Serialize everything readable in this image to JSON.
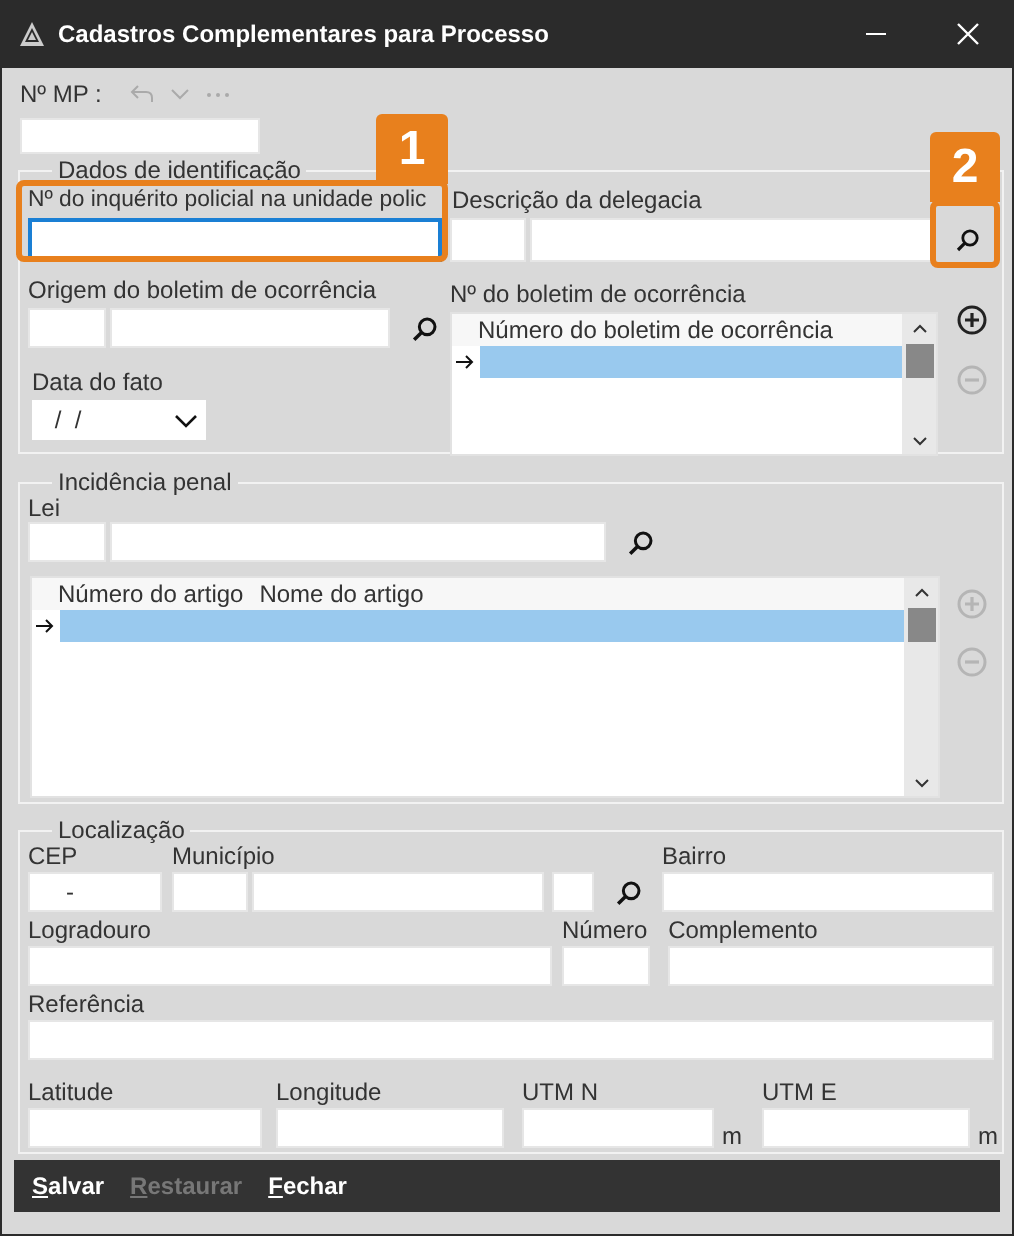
{
  "window": {
    "title": "Cadastros Complementares para Processo"
  },
  "header": {
    "mp_label": "Nº MP :"
  },
  "identificacao": {
    "title": "Dados de identificação",
    "inquerito": {
      "label": "Nº do inquérito policial na unidade polic",
      "focused": true
    },
    "delegacia": {
      "label": "Descrição da delegacia"
    },
    "origem": {
      "label": "Origem do boletim de ocorrência"
    },
    "data": {
      "label": "Data do fato",
      "value": " /  /"
    },
    "boletim": {
      "label": "Nº do boletim de ocorrência",
      "columns": [
        "Número do boletim de ocorrência"
      ],
      "add_disabled": false,
      "remove_disabled": true
    }
  },
  "incidencia": {
    "title": "Incidência penal",
    "lei_label": "Lei",
    "columns": [
      "Número do artigo",
      "Nome do artigo"
    ],
    "add_disabled": true,
    "remove_disabled": true
  },
  "localizacao": {
    "title": "Localização",
    "fields": [
      {
        "label": "CEP",
        "value": "-"
      },
      {
        "label": "Município"
      },
      {
        "label": "Bairro"
      },
      {
        "label": "Logradouro"
      },
      {
        "label": "Número"
      },
      {
        "label": "Complemento"
      },
      {
        "label": "Referência"
      },
      {
        "label": "Latitude"
      },
      {
        "label": "Longitude"
      },
      {
        "label": "UTM N",
        "unit": "m"
      },
      {
        "label": "UTM E",
        "unit": "m"
      }
    ]
  },
  "footer": {
    "buttons": [
      {
        "label": "Salvar",
        "disabled": false
      },
      {
        "label": "Restaurar",
        "disabled": true
      },
      {
        "label": "Fechar",
        "disabled": false
      }
    ]
  },
  "callouts": [
    {
      "number": "1"
    },
    {
      "number": "2"
    }
  ]
}
